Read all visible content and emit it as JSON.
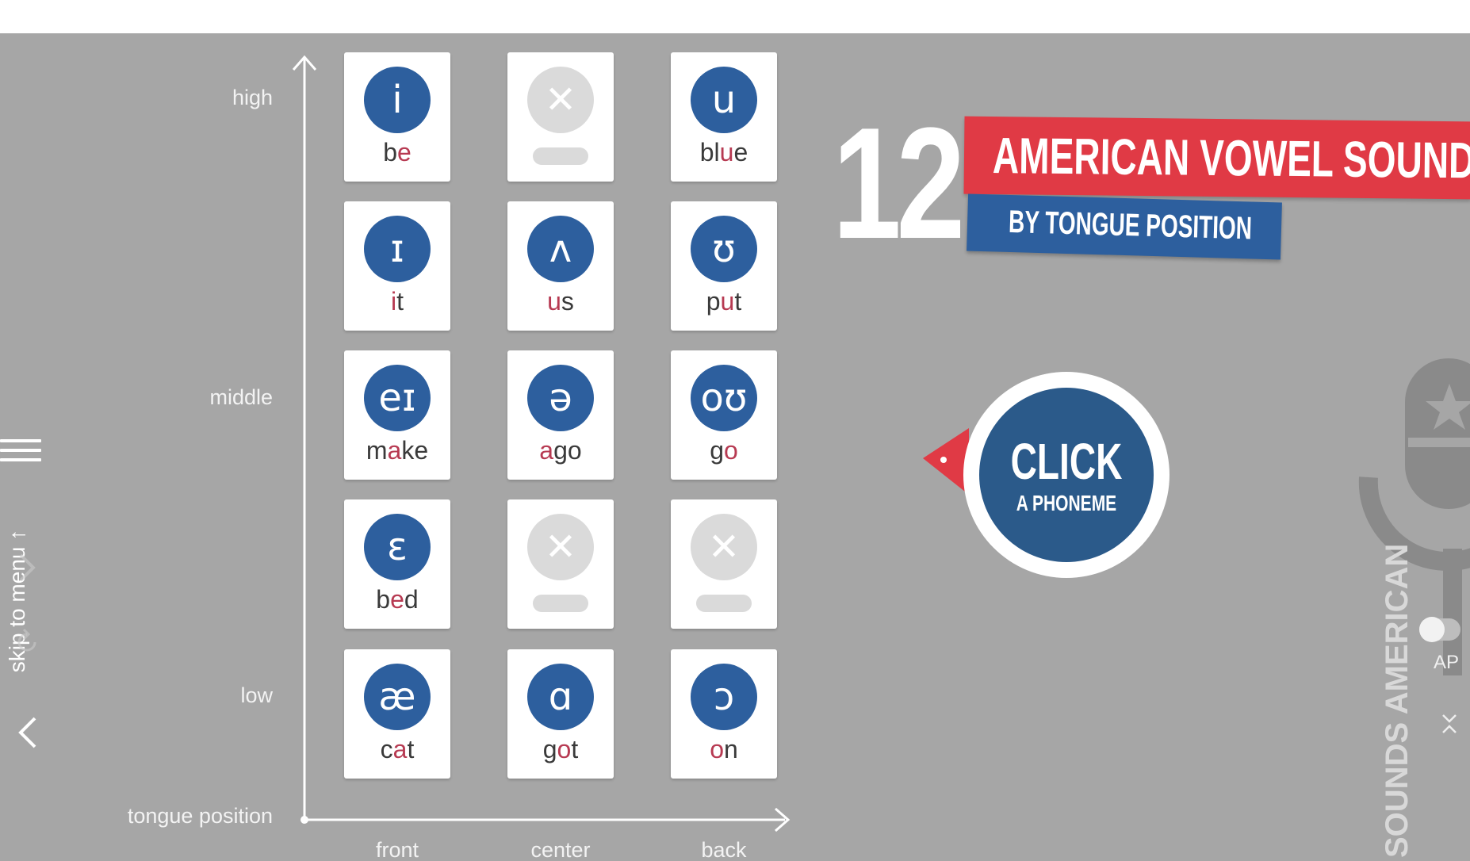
{
  "axis": {
    "y_labels": [
      "high",
      "middle",
      "low"
    ],
    "x_labels": [
      "front",
      "center",
      "back"
    ],
    "corner_label": "tongue position"
  },
  "grid": [
    [
      {
        "symbol": "i",
        "pre": "b",
        "hl": "e",
        "post": "",
        "empty": false
      },
      {
        "symbol": "✕",
        "pre": "",
        "hl": "",
        "post": "",
        "empty": true
      },
      {
        "symbol": "u",
        "pre": "bl",
        "hl": "u",
        "post": "e",
        "empty": false
      }
    ],
    [
      {
        "symbol": "ɪ",
        "pre": "",
        "hl": "i",
        "post": "t",
        "empty": false
      },
      {
        "symbol": "ʌ",
        "pre": "",
        "hl": "u",
        "post": "s",
        "empty": false
      },
      {
        "symbol": "ʊ",
        "pre": "p",
        "hl": "u",
        "post": "t",
        "empty": false
      }
    ],
    [
      {
        "symbol": "eɪ",
        "pre": "m",
        "hl": "a",
        "post": "ke",
        "empty": false
      },
      {
        "symbol": "ə",
        "pre": "",
        "hl": "a",
        "post": "go",
        "empty": false
      },
      {
        "symbol": "oʊ",
        "pre": "g",
        "hl": "o",
        "post": "",
        "empty": false
      }
    ],
    [
      {
        "symbol": "ɛ",
        "pre": "b",
        "hl": "e",
        "post": "d",
        "empty": false
      },
      {
        "symbol": "✕",
        "pre": "",
        "hl": "",
        "post": "",
        "empty": true
      },
      {
        "symbol": "✕",
        "pre": "",
        "hl": "",
        "post": "",
        "empty": true
      }
    ],
    [
      {
        "symbol": "æ",
        "pre": "c",
        "hl": "a",
        "post": "t",
        "empty": false
      },
      {
        "symbol": "ɑ",
        "pre": "g",
        "hl": "o",
        "post": "t",
        "empty": false
      },
      {
        "symbol": "ɔ",
        "pre": "",
        "hl": "o",
        "post": "n",
        "empty": false
      }
    ]
  ],
  "title": {
    "number": "12",
    "main": "AMERICAN VOWEL SOUNDS",
    "sub": "BY TONGUE POSITION"
  },
  "cta": {
    "line1": "CLICK",
    "line2": "A PHONEME"
  },
  "nav": {
    "skip_label": "skip to menu ↑",
    "ap_label": "AP",
    "side_brand": "SOUNDS AMERICAN"
  },
  "colors": {
    "background": "#a6a6a6",
    "phoneme_blue": "#2d5f9e",
    "highlight_red": "#b73a52",
    "banner_red": "#e03a45"
  }
}
